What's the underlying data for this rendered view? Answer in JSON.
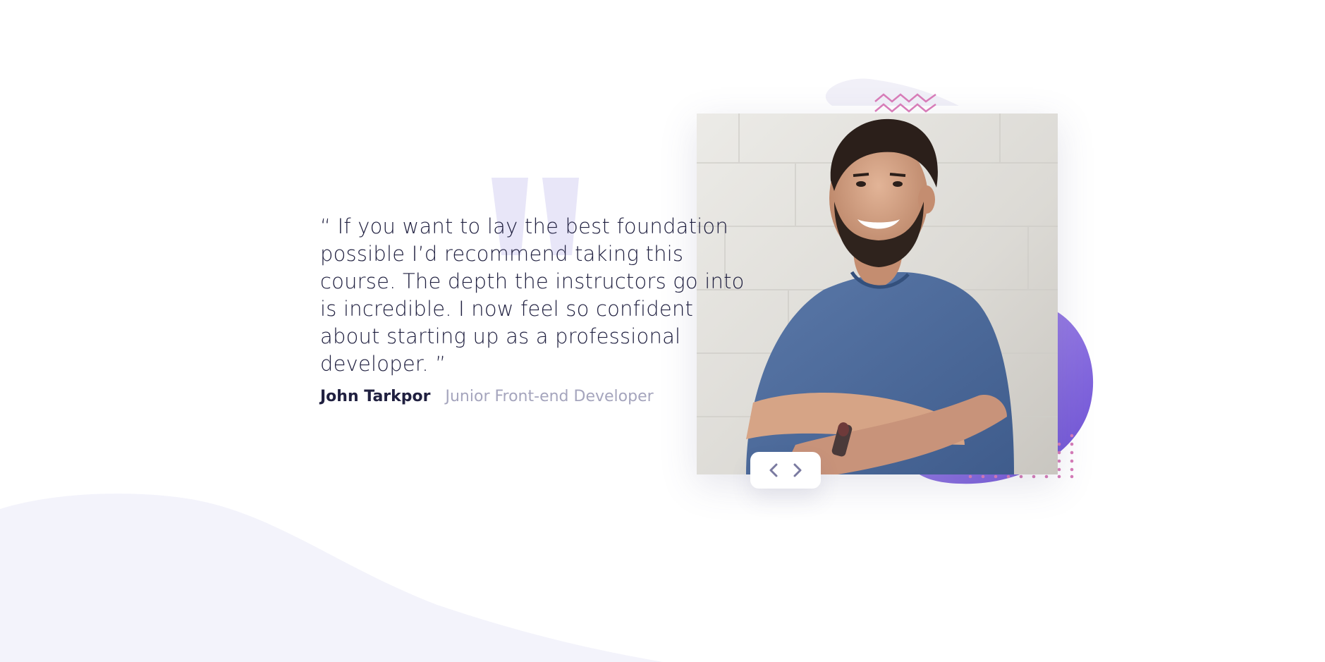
{
  "testimonial": {
    "quote": "“ If you want to lay the best foundation possible I’d recommend taking this course. The depth the instructors go into is incredible. I now feel so confident about starting up as a professional developer. ”",
    "author_name": "John Tarkpor",
    "author_role": "Junior Front-end Developer"
  },
  "icons": {
    "quote_decoration": "quote-mark-icon",
    "prev": "chevron-left-icon",
    "next": "chevron-right-icon"
  },
  "colors": {
    "text_dark": "#202040",
    "text_muted": "#a5a5bd",
    "background_curve": "#f3f3fb",
    "quote_mark": "#e8e6f8",
    "blob_start": "#a98ee8",
    "blob_end": "#6c4fd6",
    "zigzag": "#d77cb8",
    "dots": "#d77cb8",
    "nav_icon": "#7a7aa0"
  }
}
